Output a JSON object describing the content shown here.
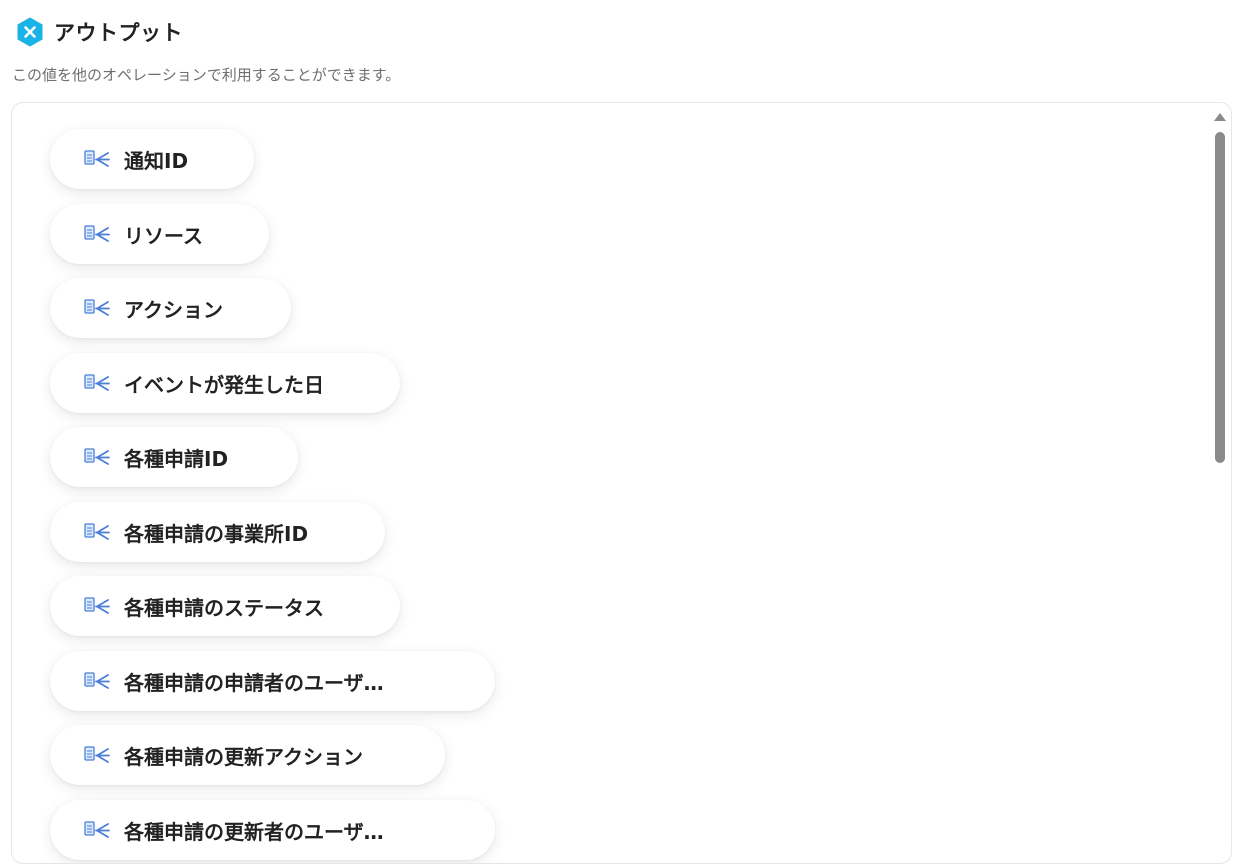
{
  "header": {
    "title": "アウトプット",
    "icon": "x-hexagon-icon",
    "icon_color": "#1bb3e6"
  },
  "description": "この値を他のオペレーションで利用することができます。",
  "outputs": [
    {
      "label": "通知ID",
      "icon": "variable-chip-icon"
    },
    {
      "label": "リソース",
      "icon": "variable-chip-icon"
    },
    {
      "label": "アクション",
      "icon": "variable-chip-icon"
    },
    {
      "label": "イベントが発生した日",
      "icon": "variable-chip-icon"
    },
    {
      "label": "各種申請ID",
      "icon": "variable-chip-icon"
    },
    {
      "label": "各種申請の事業所ID",
      "icon": "variable-chip-icon"
    },
    {
      "label": "各種申請のステータス",
      "icon": "variable-chip-icon"
    },
    {
      "label": "各種申請の申請者のユーザ…",
      "icon": "variable-chip-icon"
    },
    {
      "label": "各種申請の更新アクション",
      "icon": "variable-chip-icon"
    },
    {
      "label": "各種申請の更新者のユーザ…",
      "icon": "variable-chip-icon"
    }
  ],
  "colors": {
    "accent": "#1bb3e6",
    "chip_icon": "#4a7fd8",
    "text": "#222222",
    "muted_text": "#6f6f6f"
  }
}
